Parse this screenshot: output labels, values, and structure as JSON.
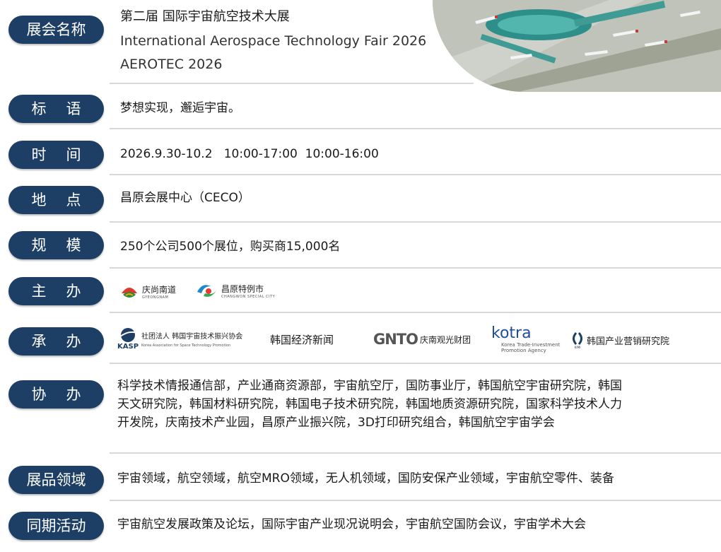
{
  "rows": {
    "name": {
      "label": "展会名称",
      "line1": "第二届 国际宇宙航空技术大展",
      "line2": "International Aerospace Technology Fair 2026",
      "line3": "AEROTEC 2026"
    },
    "slogan": {
      "label_a": "标",
      "label_b": "语",
      "value": "梦想实现，邂逅宇宙。"
    },
    "time": {
      "label_a": "时",
      "label_b": "间",
      "value": "2026.9.30-10.2   10:00-17:00  10:00-16:00"
    },
    "venue": {
      "label_a": "地",
      "label_b": "点",
      "value": "昌原会展中心（CECO）"
    },
    "scale": {
      "label_a": "规",
      "label_b": "模",
      "value": "250个公司500个展位，购买商15,000名"
    },
    "host": {
      "label_a": "主",
      "label_b": "办",
      "logos": [
        {
          "name": "庆尚南道",
          "sub": "GYEONGNAM"
        },
        {
          "name": "昌原特例市",
          "sub": "CHANGWON SPECIAL CITY"
        }
      ]
    },
    "organizer": {
      "label_a": "承",
      "label_b": "办",
      "kasp_abbr": "KASP",
      "kasp_name": "社团法人 韩国宇宙技术振兴协会",
      "kasp_sub": "Korea Association for Space Technology Promotion",
      "news": "韩国经济新闻",
      "gnto_mark": "GNTO",
      "gnto_name": "庆南观光财团",
      "kotra_mark": "kotra",
      "kotra_sub1": "Korea Trade-Investment",
      "kotra_sub2": "Promotion Agency",
      "kimi_name": "韩国产业营销研究院",
      "kimi_abbr": "KIMI"
    },
    "cohost": {
      "label_a": "协",
      "label_b": "办",
      "line1": "科学技术情报通信部，产业通商资源部，宇宙航空厅，国防事业厅，韩国航空宇宙研究院，韩国",
      "line2": "天文研究院，韩国材料研究院，韩国电子技术研究院，韩国地质资源研究院，国家科学技术人力",
      "line3": "开发院，庆南技术产业园，昌原产业振兴院，3D打印研究组合，韩国航空宇宙学会"
    },
    "exhibits": {
      "label": "展品领域",
      "value": "宇宙领域，航空领域，航空MRO领域，无人机领域，国防安保产业领域，宇宙航空零件、装备"
    },
    "events": {
      "label": "同期活动",
      "value": "宇宙航空发展政策及论坛，国际宇宙产业现况说明会，宇宙航空国防会议，宇宙学术大会"
    }
  },
  "colors": {
    "pill": "#1d3f66",
    "divider": "#d8d8d8",
    "text": "#1a1a1a"
  }
}
